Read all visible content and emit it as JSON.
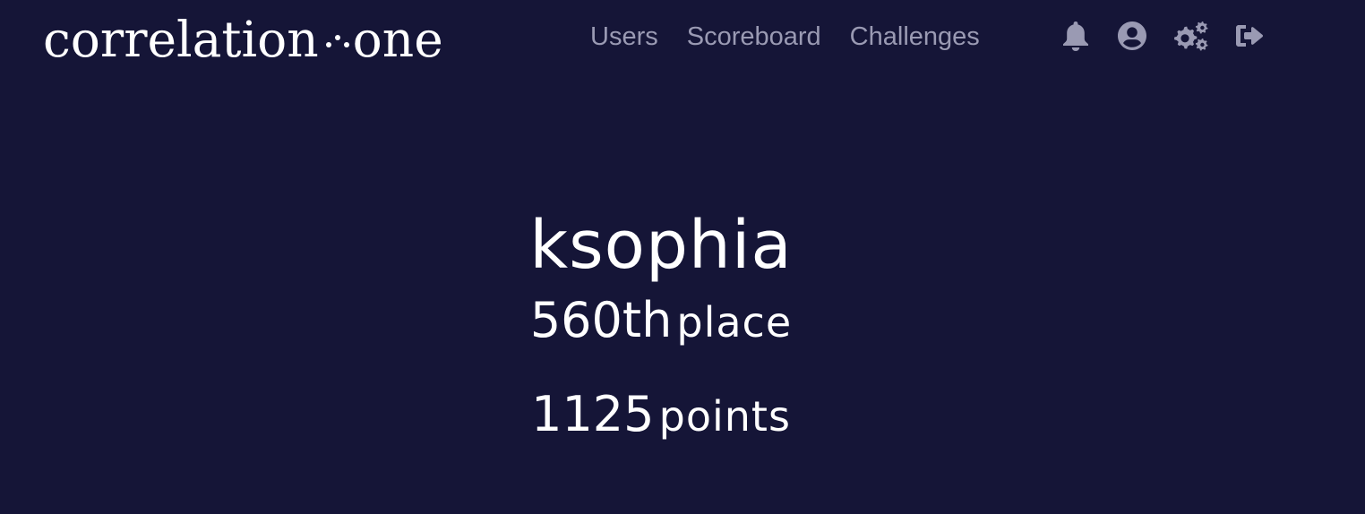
{
  "brand": {
    "logo_part1": "correlation",
    "logo_part2": "one"
  },
  "nav": {
    "links": [
      {
        "label": "Users"
      },
      {
        "label": "Scoreboard"
      },
      {
        "label": "Challenges"
      }
    ],
    "icons": [
      "bell-icon",
      "user-circle-icon",
      "gears-icon",
      "sign-out-icon"
    ]
  },
  "profile": {
    "username": "ksophia",
    "place_number": "560th",
    "place_label": "place",
    "points_number": "1125",
    "points_label": "points"
  },
  "colors": {
    "background": "#151537",
    "nav_text": "#9a9ab3",
    "text": "#ffffff"
  }
}
